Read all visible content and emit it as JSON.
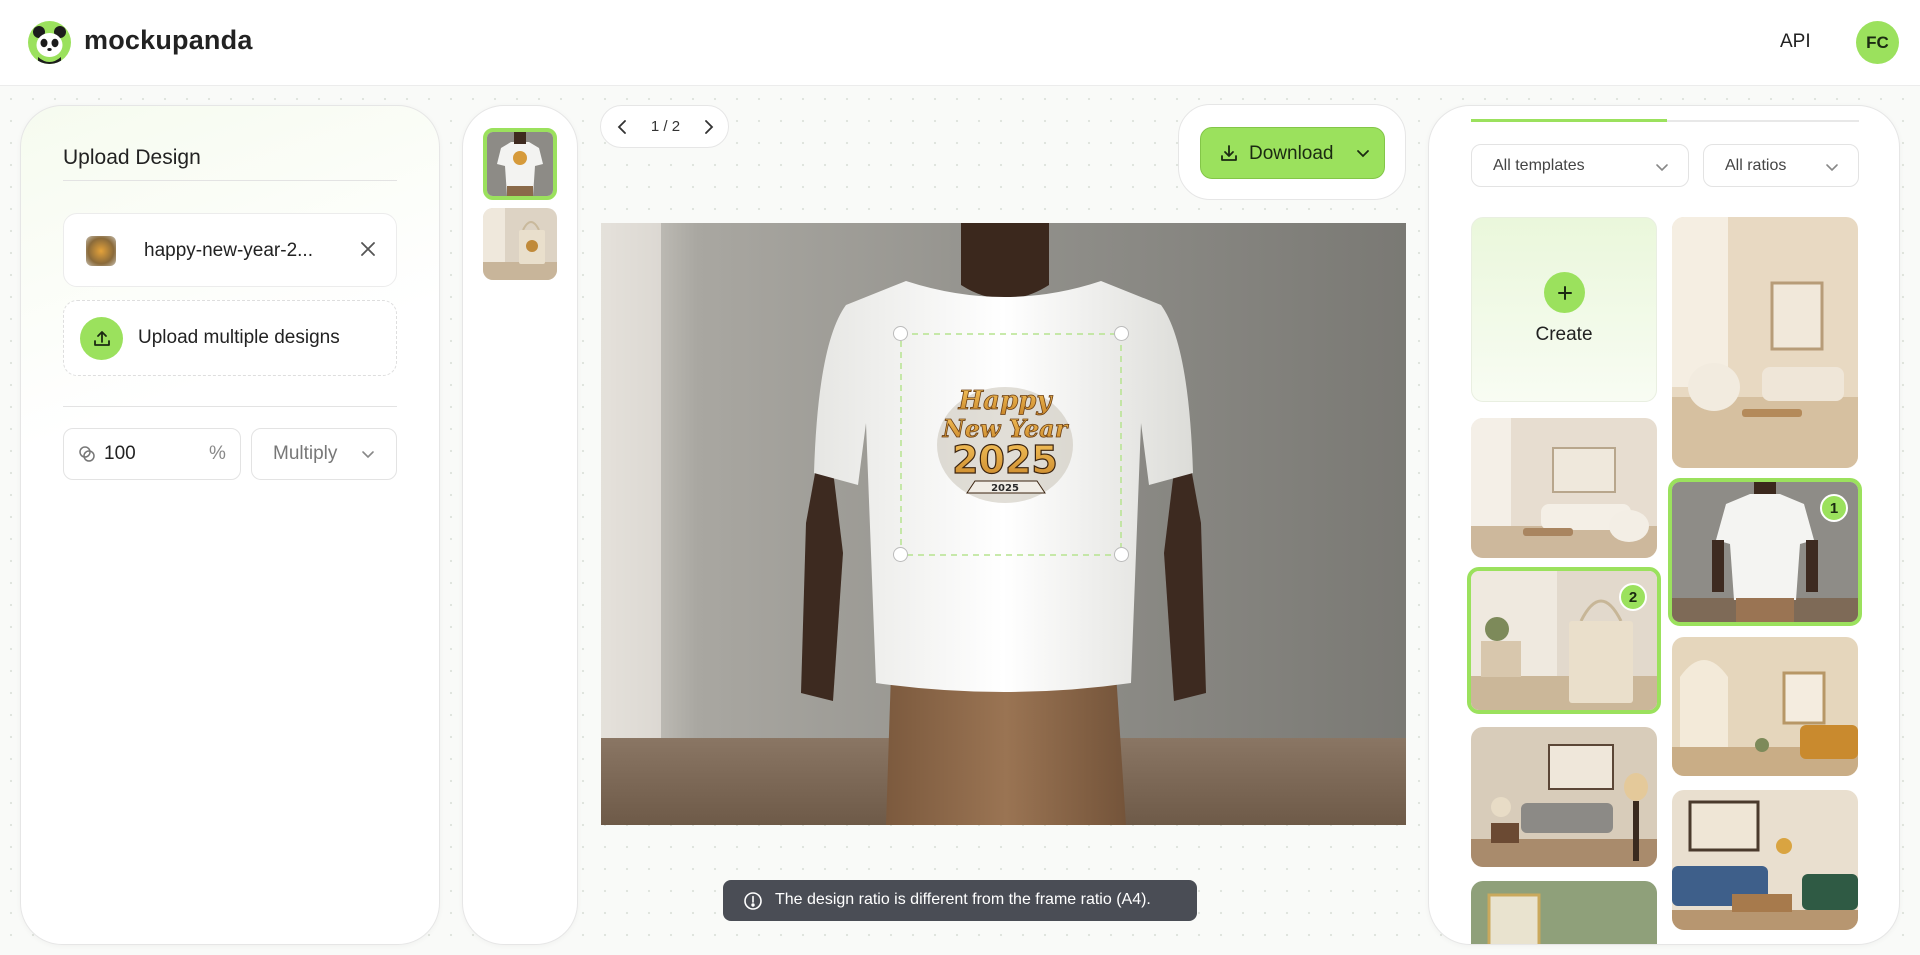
{
  "header": {
    "brand": "mockupanda",
    "api_label": "API",
    "avatar_initials": "FC"
  },
  "left_panel": {
    "title": "Upload Design",
    "file_name": "happy-new-year-2...",
    "upload_multiple_label": "Upload multiple designs",
    "opacity_value": "100",
    "opacity_unit": "%",
    "blend_mode": "Multiply"
  },
  "pager": {
    "text": "1 / 2"
  },
  "toolbar": {
    "download_label": "Download"
  },
  "toast": {
    "message": "The design ratio is different from the frame ratio (A4)."
  },
  "right_panel": {
    "template_filter": "All templates",
    "ratio_filter": "All ratios",
    "create_label": "Create",
    "badge_1": "1",
    "badge_2": "2"
  },
  "design": {
    "line1": "Happy",
    "line2": "New Year",
    "line3": "2025",
    "ribbon": "2025"
  },
  "colors": {
    "accent": "#9be15d",
    "toast_bg": "#4a4d55"
  }
}
